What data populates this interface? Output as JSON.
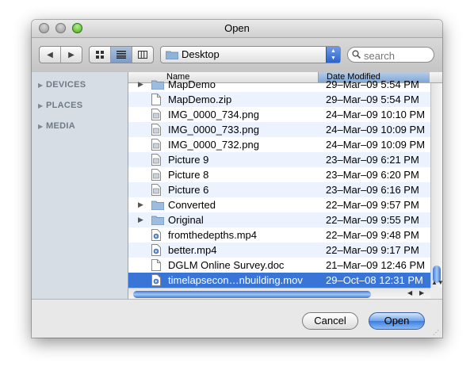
{
  "window": {
    "title": "Open"
  },
  "toolbar": {
    "location": "Desktop",
    "search_placeholder": "search"
  },
  "sidebar": {
    "sections": [
      {
        "label": "DEVICES"
      },
      {
        "label": "PLACES"
      },
      {
        "label": "MEDIA"
      }
    ]
  },
  "columns": {
    "name": "Name",
    "date": "Date Modified"
  },
  "files": [
    {
      "name": "MapDemo",
      "date": "29–Mar–09 5:54 PM",
      "kind": "folder",
      "expandable": true
    },
    {
      "name": "MapDemo.zip",
      "date": "29–Mar–09 5:54 PM",
      "kind": "document"
    },
    {
      "name": "IMG_0000_734.png",
      "date": "24–Mar–09 10:10 PM",
      "kind": "image"
    },
    {
      "name": "IMG_0000_733.png",
      "date": "24–Mar–09 10:09 PM",
      "kind": "image"
    },
    {
      "name": "IMG_0000_732.png",
      "date": "24–Mar–09 10:09 PM",
      "kind": "image"
    },
    {
      "name": "Picture 9",
      "date": "23–Mar–09 6:21 PM",
      "kind": "image"
    },
    {
      "name": "Picture 8",
      "date": "23–Mar–09 6:20 PM",
      "kind": "image"
    },
    {
      "name": "Picture 6",
      "date": "23–Mar–09 6:16 PM",
      "kind": "image"
    },
    {
      "name": "Converted",
      "date": "22–Mar–09 9:57 PM",
      "kind": "folder",
      "expandable": true
    },
    {
      "name": "Original",
      "date": "22–Mar–09 9:55 PM",
      "kind": "folder",
      "expandable": true
    },
    {
      "name": "fromthedepths.mp4",
      "date": "22–Mar–09 9:48 PM",
      "kind": "video"
    },
    {
      "name": "better.mp4",
      "date": "22–Mar–09 9:17 PM",
      "kind": "video"
    },
    {
      "name": "DGLM Online Survey.doc",
      "date": "21–Mar–09 12:46 PM",
      "kind": "document"
    },
    {
      "name": "timelapsecon…nbuilding.mov",
      "date": "29–Oct–08 12:31 PM",
      "kind": "video",
      "selected": true
    }
  ],
  "buttons": {
    "cancel": "Cancel",
    "open": "Open"
  }
}
